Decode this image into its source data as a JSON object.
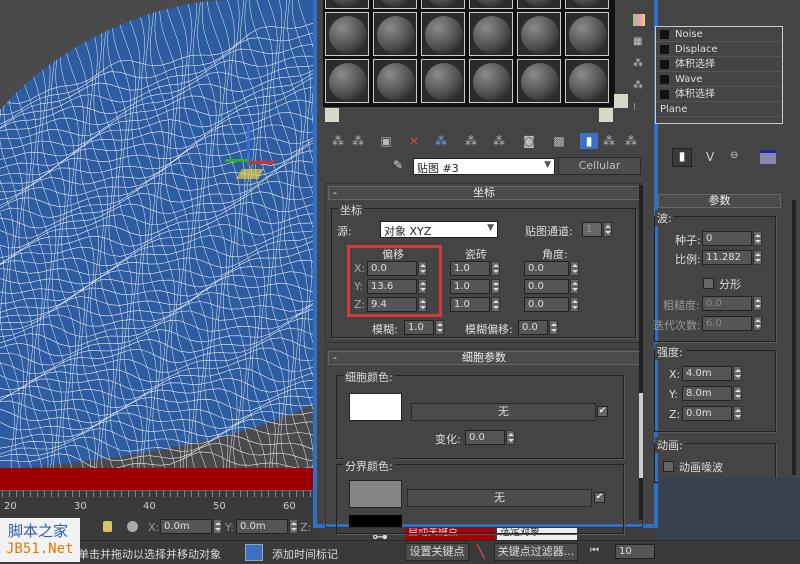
{
  "viewport": {
    "ruler_labels": [
      "20",
      "30",
      "40",
      "50",
      "60"
    ],
    "coord_x": "0.0m",
    "coord_y": "0.0m",
    "x_label": "X:",
    "y_label": "Y:",
    "z_label": "Z:",
    "status_text": "单击并拖动以选择并移动对象",
    "add_time_tag": "添加时间标记",
    "watermark": {
      "line1": "脚本之家",
      "line2": "JB51.Net"
    }
  },
  "material_editor": {
    "map_name": "贴图 #3",
    "map_type": "Cellular",
    "coords_rollout": {
      "title": "坐标",
      "group": "坐标",
      "source_label": "源:",
      "source_value": "对象 XYZ",
      "map_channel_label": "贴图通道:",
      "map_channel_value": "1",
      "offset_header": "偏移",
      "tiling_header": "瓷砖",
      "angle_header": "角度:",
      "rows": [
        {
          "axis": "X:",
          "offset": "0.0",
          "tiling": "1.0",
          "angle": "0.0"
        },
        {
          "axis": "Y:",
          "offset": "13.6",
          "tiling": "1.0",
          "angle": "0.0"
        },
        {
          "axis": "Z:",
          "offset": "9.4",
          "tiling": "1.0",
          "angle": "0.0"
        }
      ],
      "blur_label": "模糊:",
      "blur_value": "1.0",
      "blur_offset_label": "模糊偏移:",
      "blur_offset_value": "0.0"
    },
    "cell_rollout": {
      "title": "细胞参数",
      "cell_color_label": "细胞颜色:",
      "none_label": "无",
      "variation_label": "变化:",
      "variation_value": "0.0",
      "division_color_label": "分界颜色:",
      "none_label2": "无"
    },
    "highlight_color": "#d33a3a"
  },
  "command_panel": {
    "stack": [
      {
        "label": "Noise",
        "plus": true
      },
      {
        "label": "Displace",
        "plus": true
      },
      {
        "label": "体积选择",
        "plus": true
      },
      {
        "label": "Wave",
        "plus": true
      },
      {
        "label": "体积选择",
        "plus": true
      },
      {
        "label": "Plane",
        "plus": false
      }
    ],
    "params_title": "参数",
    "noise_group": "波:",
    "seed_label": "种子:",
    "seed_value": "0",
    "scale_label": "比例:",
    "scale_value": "11.282",
    "fractal_label": "分形",
    "roughness_label": "粗糙度:",
    "roughness_value": "0.0",
    "iterations_label": "迭代次数:",
    "iterations_value": "6.0",
    "strength_group": "强度:",
    "x_label": "X:",
    "x_value": "4.0m",
    "y_label": "Y:",
    "y_value": "8.0m",
    "z_label": "Z:",
    "z_value": "0.0m",
    "anim_group": "动画:",
    "animate_noise_label": "动画噪波"
  },
  "bottom": {
    "auto_key": "自动关键点",
    "set_key": "设置关键点",
    "key_filters": "关键点过滤器...",
    "selected": "选定对象",
    "frame_value": "10"
  }
}
